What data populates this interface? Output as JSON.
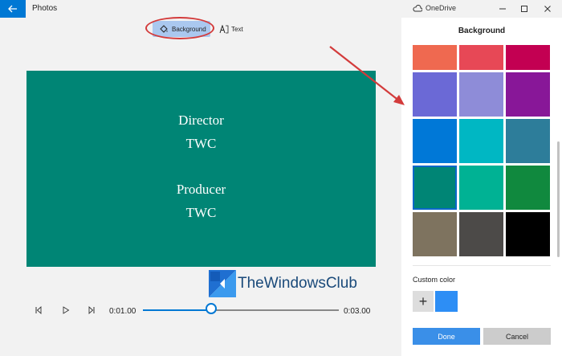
{
  "titlebar": {
    "app_title": "Photos",
    "onedrive_label": "OneDrive",
    "back_icon": "back-arrow-icon",
    "minimize_icon": "minimize-icon",
    "maximize_icon": "maximize-icon",
    "close_icon": "close-icon"
  },
  "toolbar": {
    "background_label": "Background",
    "text_label": "Text"
  },
  "preview": {
    "lines": [
      "Director",
      "TWC",
      "Producer",
      "TWC"
    ],
    "background_color": "#008575"
  },
  "watermark": {
    "text": "TheWindowsClub"
  },
  "playback": {
    "current_time": "0:01.00",
    "total_time": "0:03.00",
    "progress": 0.35
  },
  "panel": {
    "title": "Background",
    "swatches": [
      {
        "color": "#ef6950",
        "selected": false
      },
      {
        "color": "#e74856",
        "selected": false
      },
      {
        "color": "#c30052",
        "selected": false
      },
      {
        "color": "#6b69d6",
        "selected": false
      },
      {
        "color": "#8e8cd8",
        "selected": false
      },
      {
        "color": "#881798",
        "selected": false
      },
      {
        "color": "#0078d7",
        "selected": false
      },
      {
        "color": "#00b7c3",
        "selected": false
      },
      {
        "color": "#2d7d9a",
        "selected": false
      },
      {
        "color": "#008575",
        "selected": true
      },
      {
        "color": "#00b294",
        "selected": false
      },
      {
        "color": "#10893e",
        "selected": false
      },
      {
        "color": "#7e735f",
        "selected": false
      },
      {
        "color": "#4c4a48",
        "selected": false
      },
      {
        "color": "#000000",
        "selected": false
      }
    ],
    "custom_color_label": "Custom color",
    "custom_color": "#2d8ef5",
    "done_label": "Done",
    "cancel_label": "Cancel"
  },
  "accent_color": "#0078d4",
  "annotation_color": "#d33b3b"
}
